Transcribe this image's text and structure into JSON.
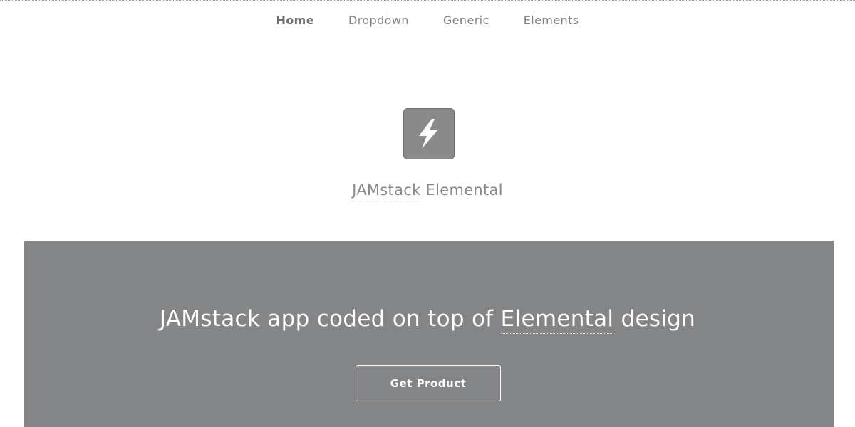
{
  "nav": {
    "items": [
      {
        "label": "Home",
        "active": true
      },
      {
        "label": "Dropdown",
        "active": false
      },
      {
        "label": "Generic",
        "active": false
      },
      {
        "label": "Elements",
        "active": false
      }
    ]
  },
  "logo": {
    "icon": "lightning-bolt-icon",
    "color": "#8a8a8a"
  },
  "site_title": {
    "link_text": "JAMstack",
    "rest_text": " Elemental"
  },
  "banner": {
    "background": "#838587",
    "headline_prefix": "JAMstack app coded on top of ",
    "headline_link": "Elemental",
    "headline_suffix": " design",
    "cta_label": "Get Product"
  }
}
